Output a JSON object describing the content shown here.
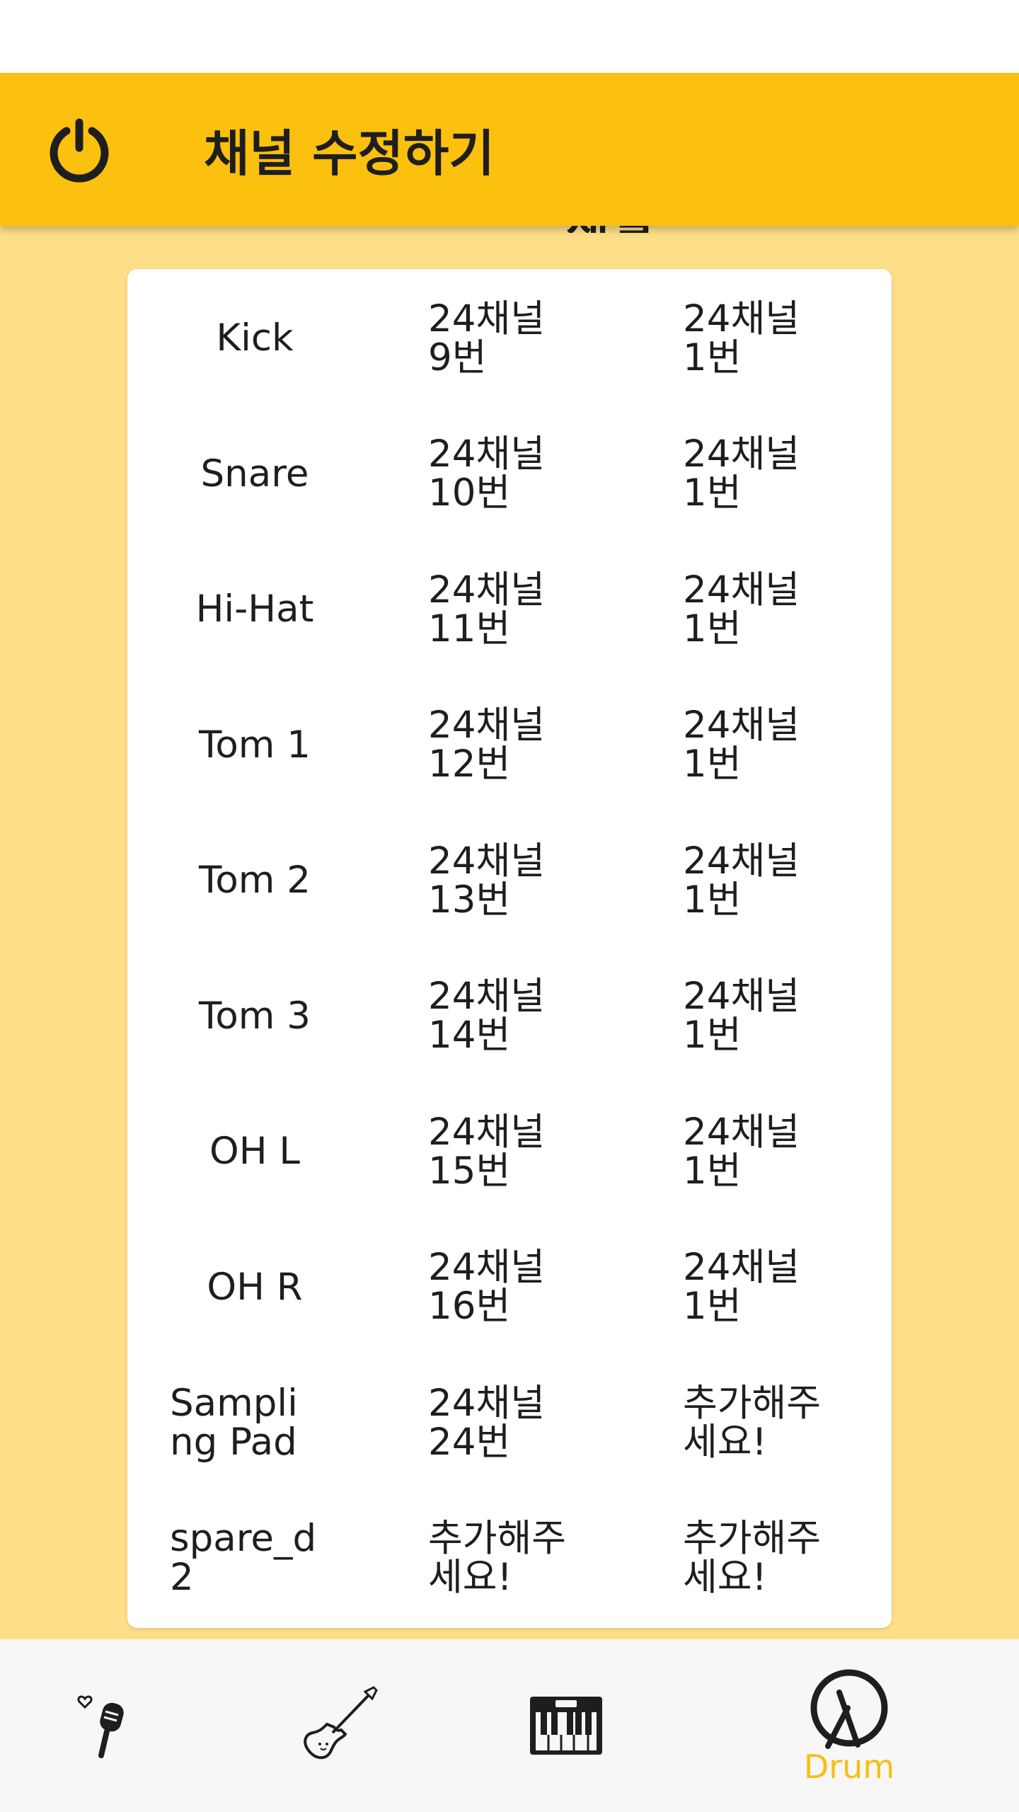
{
  "header": {
    "title": "채널 수정하기",
    "accent_color": "#FCC00E",
    "power_icon": "power-icon"
  },
  "channels": [
    {
      "name": "Kick",
      "main": "24채널 9번",
      "sub": "24채널 1번"
    },
    {
      "name": "Snare",
      "main": "24채널 10번",
      "sub": "24채널 1번"
    },
    {
      "name": "Hi-Hat",
      "main": "24채널 11번",
      "sub": "24채널 1번"
    },
    {
      "name": "Tom 1",
      "main": "24채널 12번",
      "sub": "24채널 1번"
    },
    {
      "name": "Tom 2",
      "main": "24채널 13번",
      "sub": "24채널 1번"
    },
    {
      "name": "Tom 3",
      "main": "24채널 14번",
      "sub": "24채널 1번"
    },
    {
      "name": "OH L",
      "main": "24채널 15번",
      "sub": "24채널 1번"
    },
    {
      "name": "OH R",
      "main": "24채널 16번",
      "sub": "24채널 1번"
    },
    {
      "name": "Sampling Pad",
      "main": "24채널 24번",
      "sub": "추가해주세요!"
    },
    {
      "name": "spare_d2",
      "main": "추가해주세요!",
      "sub": "추가해주세요!"
    }
  ],
  "bottom_nav": {
    "items": [
      {
        "icon": "microphone-icon"
      },
      {
        "icon": "guitar-icon"
      },
      {
        "icon": "keyboard-icon"
      },
      {
        "icon": "drum-icon",
        "label": "Drum",
        "active": true
      }
    ],
    "active_color": "#F9BE10"
  }
}
